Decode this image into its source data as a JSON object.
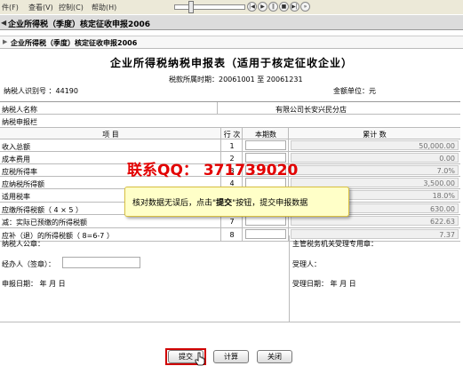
{
  "menu": {
    "items": [
      "件(F)",
      "查看(V)",
      "控制(C)",
      "帮助(H)"
    ]
  },
  "window": {
    "title": "企业所得税（季度）核定征收申报2006"
  },
  "tab": {
    "label": "企业所得税（季度）核定征收申报2006"
  },
  "form": {
    "title": "企业所得税纳税申报表（适用于核定征收企业）",
    "period_label": "税款所属时期：",
    "period_start": "20061001",
    "period_sep": "至",
    "period_end": "20061231",
    "taxid_label": "纳税人识别号 ：44190",
    "unit_label": "金额单位：元",
    "taxpayer_name_label": "纳税人名称",
    "taxpayer_name_value": "有限公司长安兴民分店",
    "section_label": "纳税申报栏",
    "col_item": "项  目",
    "col_line": "行 次",
    "col_period": "本期数",
    "col_cumulative": "累计 数",
    "rows": [
      {
        "label": "收入总额",
        "line": "1",
        "cumulative": "50,000.00"
      },
      {
        "label": "成本费用",
        "line": "2",
        "cumulative": "0.00"
      },
      {
        "label": "应税所得率",
        "line": "3",
        "cumulative": "7.0%"
      },
      {
        "label": "应纳税所得额",
        "line": "4",
        "cumulative": "3,500.00"
      },
      {
        "label": "适用税率",
        "line": "5",
        "cumulative": "18.0%"
      },
      {
        "label": "应缴所得税额（ 4 × 5 ）",
        "line": "6",
        "cumulative": "630.00"
      },
      {
        "label": "减：实际已预缴的所得税额",
        "line": "7",
        "cumulative": "622.63"
      },
      {
        "label": "应补（退）的所得税额（ 8=6-7 ）",
        "line": "8",
        "cumulative": "7.37"
      }
    ],
    "footer": {
      "seal_label": "纳税人公章：",
      "agent_label": "经办人（签章）：",
      "date_label": "申报日期： 年  月  日",
      "tax_office_label": "主管税务机关受理专用章：",
      "receiver_label": "受理人：",
      "receive_date_label": "受理日期： 年  月  日"
    }
  },
  "buttons": {
    "submit": "提交",
    "calculate": "计算",
    "close": "关闭"
  },
  "overlay": {
    "watermark": "联系QQ： 371739020",
    "tooltip_pre": "核对数据无误后，点击\"",
    "tooltip_bold": "提交",
    "tooltip_post": "\"按钮，提交申报数据"
  },
  "colors": {
    "highlight": "#d00000",
    "tooltip_bg": "#ffffc8",
    "watermark": "#e30000"
  }
}
